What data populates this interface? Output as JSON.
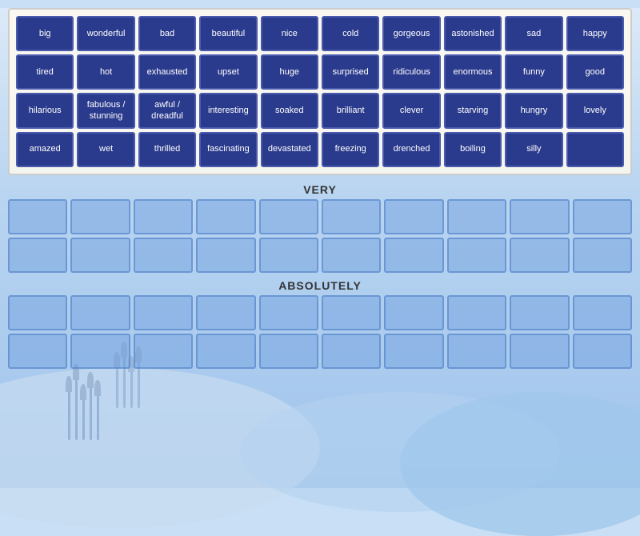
{
  "wordBank": {
    "rows": [
      [
        "big",
        "wonderful",
        "bad",
        "beautiful",
        "nice",
        "cold",
        "gorgeous",
        "astonished",
        "sad",
        "happy"
      ],
      [
        "tired",
        "hot",
        "exhausted",
        "upset",
        "huge",
        "surprised",
        "ridiculous",
        "enormous",
        "funny",
        "good"
      ],
      [
        "hilarious",
        "fabulous /\nstunning",
        "awful /\ndreadful",
        "interesting",
        "soaked",
        "brilliant",
        "clever",
        "starving",
        "hungry",
        "lovely"
      ],
      [
        "amazed",
        "wet",
        "thrilled",
        "fascinating",
        "devastated",
        "freezing",
        "drenched",
        "boiling",
        "silly",
        ""
      ]
    ]
  },
  "sections": {
    "very": {
      "label": "VERY",
      "rows": 2,
      "cols": 10
    },
    "absolutely": {
      "label": "ABSOLUTELY",
      "rows": 2,
      "cols": 10
    }
  }
}
